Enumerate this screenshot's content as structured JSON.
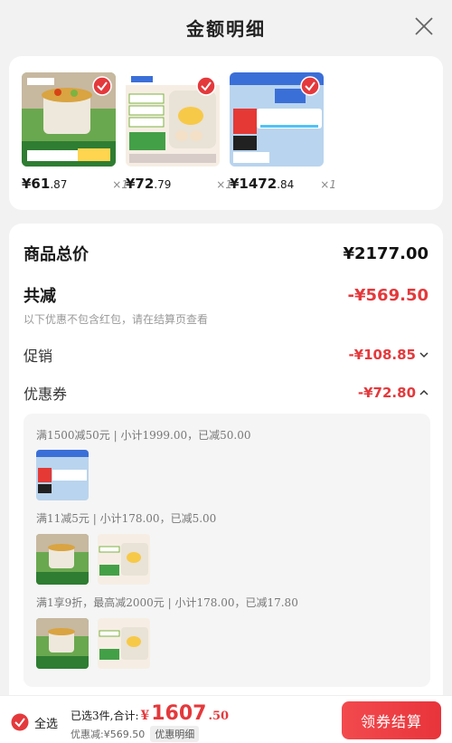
{
  "header": {
    "title": "金额明细"
  },
  "products": [
    {
      "price_int": "¥61",
      "price_dec": ".87",
      "qty": "×1",
      "check_color": "#e4393c"
    },
    {
      "price_int": "¥72",
      "price_dec": ".79",
      "qty": "×1",
      "check_color": "#e4393c"
    },
    {
      "price_int": "¥1472",
      "price_dec": ".84",
      "qty": "×1",
      "check_color": "#e4393c"
    }
  ],
  "details": {
    "total_label": "商品总价",
    "total_value": "¥2177.00",
    "discount_label": "共减",
    "discount_value": "-¥569.50",
    "note": "以下优惠不包含红包，请在结算页查看",
    "promo_label": "促销",
    "promo_value": "-¥108.85",
    "coupon_label": "优惠券",
    "coupon_value": "-¥72.80"
  },
  "coupon_rules": [
    "满1500减50元 | 小计1999.00，已减50.00",
    "满11减5元 | 小计178.00，已减5.00",
    "满1享9折，最高减2000元 | 小计178.00，已减17.80"
  ],
  "bottom": {
    "select_all": "全选",
    "selected_text": "已选3件,合计:",
    "total_symbol": "¥",
    "total_int": "1607",
    "total_dec": ".50",
    "saved_text": "优惠减:¥569.50",
    "detail_button": "优惠明细",
    "checkout_button": "领券结算"
  },
  "colors": {
    "accent": "#e4393c"
  }
}
